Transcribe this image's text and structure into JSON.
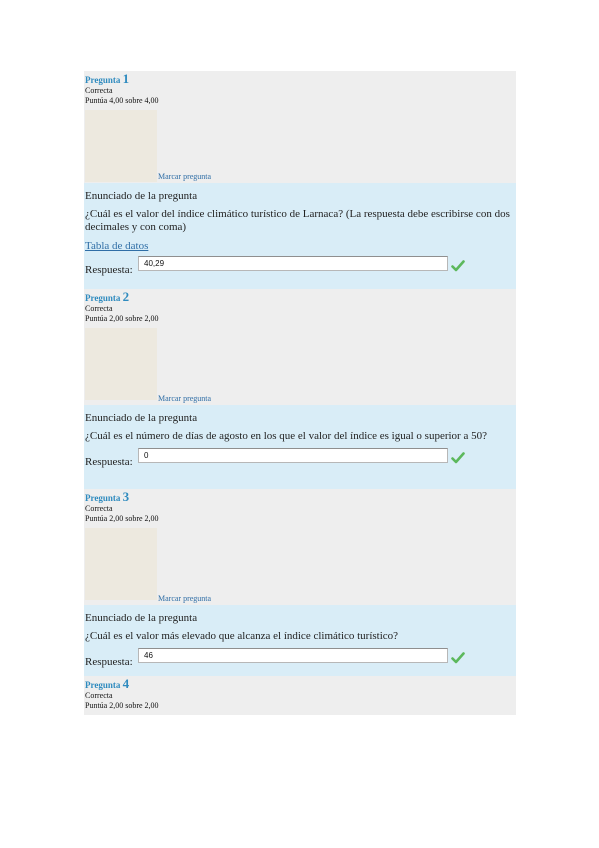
{
  "questions": [
    {
      "label": "Pregunta",
      "number": "1",
      "status": "Correcta",
      "grade": "Puntúa 4,00 sobre 4,00",
      "flag_label": "Marcar pregunta",
      "title": "Enunciado de la pregunta",
      "text": "¿Cuál es el valor del índice climático turístico de Larnaca? (La respuesta debe escribirse con dos decimales y con coma)",
      "link": "Tabla de datos",
      "answer_label": "Respuesta:",
      "answer": "40,29"
    },
    {
      "label": "Pregunta",
      "number": "2",
      "status": "Correcta",
      "grade": "Puntúa 2,00 sobre 2,00",
      "flag_label": "Marcar pregunta",
      "title": "Enunciado de la pregunta",
      "text": "¿Cuál es el número de días de agosto en los que el valor del índice es igual o superior a 50?",
      "answer_label": "Respuesta:",
      "answer": "0"
    },
    {
      "label": "Pregunta",
      "number": "3",
      "status": "Correcta",
      "grade": "Puntúa 2,00 sobre 2,00",
      "flag_label": "Marcar pregunta",
      "title": "Enunciado de la pregunta",
      "text": "¿Cuál es el valor más elevado que alcanza el índice climático turístico?",
      "answer_label": "Respuesta:",
      "answer": "46"
    },
    {
      "label": "Pregunta",
      "number": "4",
      "status": "Correcta",
      "grade": "Puntúa 2,00 sobre 2,00"
    }
  ],
  "colors": {
    "correct_check": "#5cb85c",
    "accent": "#2f8bbf",
    "info_bg": "#eeeeee",
    "content_bg": "#d9edf7"
  }
}
